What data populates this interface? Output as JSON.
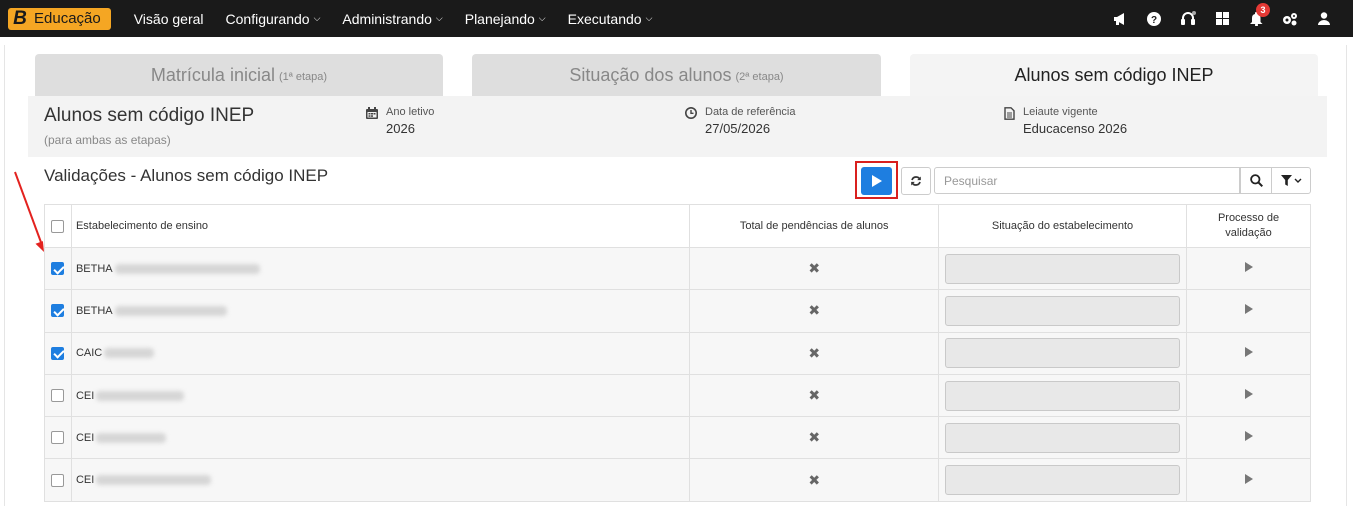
{
  "topbar": {
    "brand_logo": "B",
    "brand_name": "Educação",
    "nav": [
      {
        "label": "Visão geral",
        "dropdown": false
      },
      {
        "label": "Configurando",
        "dropdown": true
      },
      {
        "label": "Administrando",
        "dropdown": true
      },
      {
        "label": "Planejando",
        "dropdown": true
      },
      {
        "label": "Executando",
        "dropdown": true
      }
    ],
    "icons": [
      "megaphone-icon",
      "help-icon",
      "headset-icon",
      "apps-grid-icon",
      "bell-icon",
      "settings-cogs-icon",
      "user-icon"
    ],
    "notifications_count": "3"
  },
  "tabs": [
    {
      "label": "Matrícula inicial",
      "suffix": "(1ª etapa)",
      "active": false
    },
    {
      "label": "Situação dos alunos",
      "suffix": "(2ª etapa)",
      "active": false
    },
    {
      "label": "Alunos sem código INEP",
      "suffix": "",
      "active": true
    }
  ],
  "info": {
    "title": "Alunos sem código INEP",
    "subtitle": "(para ambas as etapas)",
    "ano_letivo_label": "Ano letivo",
    "ano_letivo": "2026",
    "data_ref_label": "Data de referência",
    "data_ref": "27/05/2026",
    "leiaute_label": "Leiaute vigente",
    "leiaute": "Educacenso 2026"
  },
  "section": {
    "title": "Validações - Alunos sem código INEP",
    "search_placeholder": "Pesquisar"
  },
  "table": {
    "headers": {
      "estabelecimento": "Estabelecimento de ensino",
      "total": "Total de pendências de alunos",
      "situacao": "Situação do estabelecimento",
      "processo": "Processo de validação"
    },
    "rows": [
      {
        "name": "BETHA",
        "checked": true
      },
      {
        "name": "BETHA",
        "checked": true
      },
      {
        "name": "CAIC",
        "checked": true
      },
      {
        "name": "CEI",
        "checked": false
      },
      {
        "name": "CEI",
        "checked": false
      },
      {
        "name": "CEI",
        "checked": false
      }
    ],
    "total_symbol": "✖"
  },
  "colors": {
    "accent": "#1e7ee0",
    "brand": "#f5a623",
    "highlight": "#d9201e",
    "topbar": "#1a1a1a"
  }
}
